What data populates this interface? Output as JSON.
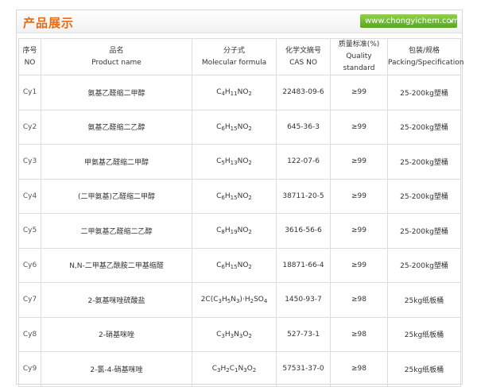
{
  "header": {
    "title": "产品展示",
    "url": "www.chongyichem.com",
    "arrow": "▸"
  },
  "columns": [
    {
      "zh": "序号",
      "en": "NO"
    },
    {
      "zh": "品名",
      "en": "Product name"
    },
    {
      "zh": "分子式",
      "en": "Molecular formula"
    },
    {
      "zh": "化学文摘号",
      "en": "CAS NO"
    },
    {
      "zh": "质量标准(%)",
      "en": "Quality standard"
    },
    {
      "zh": "包装/规格",
      "en": "Packing/Specification"
    }
  ],
  "rows": [
    {
      "no": "Cy1",
      "name": "氨基乙醛缩二甲醇",
      "formula": [
        [
          "C",
          ""
        ],
        [
          "H",
          ""
        ],
        [
          "4",
          "sub"
        ],
        [
          "H",
          ""
        ]
      ],
      "formula_text": "C4H11NO2",
      "cas": "22483-09-6",
      "quality": "≥99",
      "packing": "25-200kg塑桶"
    },
    {
      "no": "Cy2",
      "name": "氨基乙醛缩二乙醇",
      "formula_text": "C6H15NO2",
      "cas": "645-36-3",
      "quality": "≥99",
      "packing": "25-200kg塑桶"
    },
    {
      "no": "Cy3",
      "name": "甲氨基乙醛缩二甲醇",
      "formula_text": "C5H13NO2",
      "cas": "122-07-6",
      "quality": "≥99",
      "packing": "25-200kg塑桶"
    },
    {
      "no": "Cy4",
      "name": "(二甲氨基)乙醛缩二甲醇",
      "formula_text": "C6H15NO2",
      "cas": "38711-20-5",
      "quality": "≥99",
      "packing": "25-200kg塑桶"
    },
    {
      "no": "Cy5",
      "name": "二甲氨基乙醛缩二乙醇",
      "formula_text": "C8H19NO2",
      "cas": "3616-56-6",
      "quality": "≥99",
      "packing": "25-200kg塑桶"
    },
    {
      "no": "Cy6",
      "name": "N,N-二甲基乙酰胺二甲基缩醛",
      "formula_text": "C6H15NO2",
      "cas": "18871-66-4",
      "quality": "≥99",
      "packing": "25-200kg塑桶"
    },
    {
      "no": "Cy7",
      "name": "2-氨基咪唑硫酸盐",
      "formula_text": "2C(C3H5N3)·H2SO4",
      "cas": "1450-93-7",
      "quality": "≥98",
      "packing": "25kg纸板桶"
    },
    {
      "no": "Cy8",
      "name": "2-硝基咪唑",
      "formula_text": "C3H3N3O2",
      "cas": "527-73-1",
      "quality": "≥98",
      "packing": "25kg纸板桶"
    },
    {
      "no": "Cy9",
      "name": "2-氯-4-硝基咪唑",
      "formula_text": "C3H2C1N3O2",
      "cas": "57531-37-0",
      "quality": "≥98",
      "packing": "25kg纸板桶"
    }
  ],
  "colors": {
    "title": "#e86a10",
    "border": "#dcdcdc",
    "url_bg": "#6db52e"
  }
}
